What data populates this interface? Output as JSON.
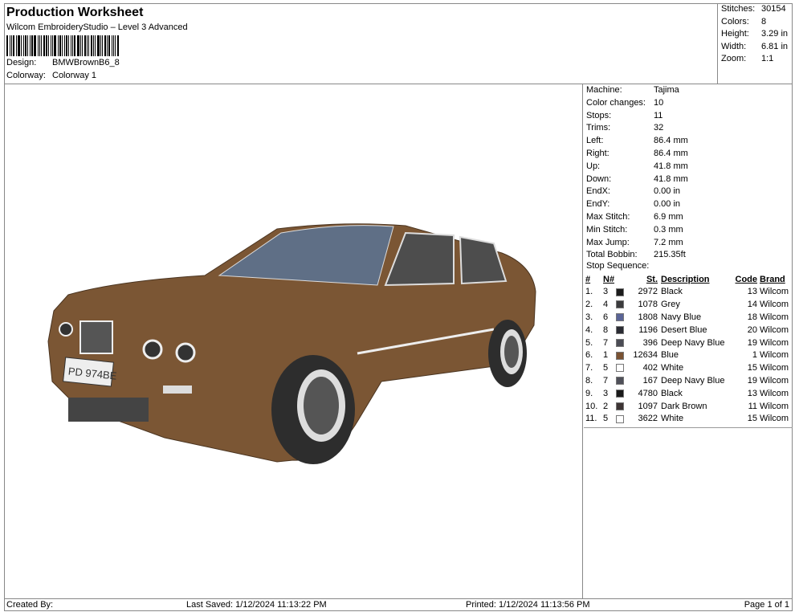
{
  "header": {
    "title": "Production Worksheet",
    "subtitle": "Wilcom EmbroideryStudio – Level 3 Advanced",
    "design_label": "Design:",
    "design_value": "BMWBrownB6_8",
    "colorway_label": "Colorway:",
    "colorway_value": "Colorway 1"
  },
  "stats": [
    {
      "label": "Stitches:",
      "value": "30154"
    },
    {
      "label": "Colors:",
      "value": "8"
    },
    {
      "label": "Height:",
      "value": "3.29 in"
    },
    {
      "label": "Width:",
      "value": "6.81 in"
    },
    {
      "label": "Zoom:",
      "value": "1:1"
    }
  ],
  "info": [
    {
      "label": "Machine:",
      "value": "Tajima"
    },
    {
      "label": "Color changes:",
      "value": "10"
    },
    {
      "label": "Stops:",
      "value": "11"
    },
    {
      "label": "Trims:",
      "value": "32"
    },
    {
      "label": "Left:",
      "value": "86.4 mm"
    },
    {
      "label": "Right:",
      "value": "86.4 mm"
    },
    {
      "label": "Up:",
      "value": "41.8 mm"
    },
    {
      "label": "Down:",
      "value": "41.8 mm"
    },
    {
      "label": "EndX:",
      "value": "0.00 in"
    },
    {
      "label": "EndY:",
      "value": "0.00 in"
    },
    {
      "label": "Max Stitch:",
      "value": "6.9 mm"
    },
    {
      "label": "Min Stitch:",
      "value": "0.3 mm"
    },
    {
      "label": "Max Jump:",
      "value": "7.2 mm"
    },
    {
      "label": "Total Bobbin:",
      "value": "215.35ft"
    }
  ],
  "stop_sequence": {
    "title": "Stop Sequence:",
    "headers": [
      "#",
      "N#",
      "St.",
      "Description",
      "Code",
      "Brand"
    ],
    "rows": [
      {
        "idx": "1.",
        "n": "3",
        "color": "#1c1c1c",
        "st": "2972",
        "desc": "Black",
        "code": "13",
        "brand": "Wilcom"
      },
      {
        "idx": "2.",
        "n": "4",
        "color": "#3b3b3d",
        "st": "1078",
        "desc": "Grey",
        "code": "14",
        "brand": "Wilcom"
      },
      {
        "idx": "3.",
        "n": "6",
        "color": "#5a6496",
        "st": "1808",
        "desc": "Navy Blue",
        "code": "18",
        "brand": "Wilcom"
      },
      {
        "idx": "4.",
        "n": "8",
        "color": "#2a2b33",
        "st": "1196",
        "desc": "Desert Blue",
        "code": "20",
        "brand": "Wilcom"
      },
      {
        "idx": "5.",
        "n": "7",
        "color": "#4b4c55",
        "st": "396",
        "desc": "Deep Navy Blue",
        "code": "19",
        "brand": "Wilcom"
      },
      {
        "idx": "6.",
        "n": "1",
        "color": "#7a5232",
        "st": "12634",
        "desc": "Blue",
        "code": "1",
        "brand": "Wilcom"
      },
      {
        "idx": "7.",
        "n": "5",
        "color": "#ffffff",
        "st": "402",
        "desc": "White",
        "code": "15",
        "brand": "Wilcom"
      },
      {
        "idx": "8.",
        "n": "7",
        "color": "#4f5059",
        "st": "167",
        "desc": "Deep Navy Blue",
        "code": "19",
        "brand": "Wilcom"
      },
      {
        "idx": "9.",
        "n": "3",
        "color": "#1a1a1a",
        "st": "4780",
        "desc": "Black",
        "code": "13",
        "brand": "Wilcom"
      },
      {
        "idx": "10.",
        "n": "2",
        "color": "#3d3434",
        "st": "1097",
        "desc": "Dark Brown",
        "code": "11",
        "brand": "Wilcom"
      },
      {
        "idx": "11.",
        "n": "5",
        "color": "#ffffff",
        "st": "3622",
        "desc": "White",
        "code": "15",
        "brand": "Wilcom"
      }
    ]
  },
  "design_image": {
    "plate_text": "PD 974BE"
  },
  "footer": {
    "created_by": "Created By:",
    "last_saved": "Last Saved: 1/12/2024 11:13:22 PM",
    "printed": "Printed: 1/12/2024 11:13:56 PM",
    "page": "Page 1 of 1"
  }
}
